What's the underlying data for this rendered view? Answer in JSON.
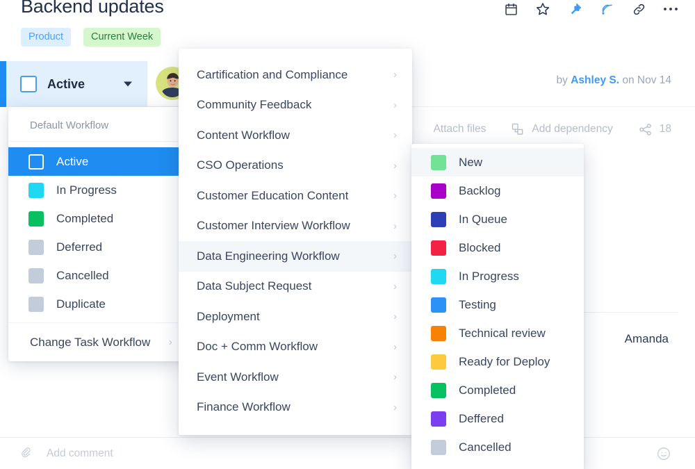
{
  "page": {
    "task_title": "Backend updates",
    "tags": [
      {
        "label": "Product",
        "bg": "#ddeeff",
        "fg": "#4da2f7"
      },
      {
        "label": "Current Week",
        "bg": "#d4f7cd",
        "fg": "#2f7a3f"
      }
    ],
    "title_icons": [
      "calendar-icon",
      "star-icon",
      "pin-icon",
      "broadcast-icon",
      "link-icon",
      "more-icon"
    ],
    "status_chip": {
      "label": "Active",
      "accent": "#1e8cf0",
      "bg": "#e2effd"
    },
    "byline": {
      "prefix": "by",
      "author": "Ashley S.",
      "date": "on Nov 14"
    },
    "actions": {
      "attach_files": "Attach files",
      "add_dependency": "Add dependency",
      "share_count": "18"
    },
    "assignee_name": "Amanda",
    "comment": {
      "placeholder": "Add comment"
    }
  },
  "status_menu": {
    "header": "Default Workflow",
    "items": [
      {
        "label": "Active",
        "color": "#ffffff",
        "hollow": true,
        "selected": true
      },
      {
        "label": "In Progress",
        "color": "#1fd8f2",
        "hollow": false,
        "selected": false
      },
      {
        "label": "Completed",
        "color": "#07c160",
        "hollow": false,
        "selected": false
      },
      {
        "label": "Deferred",
        "color": "#c3ccdb",
        "hollow": false,
        "selected": false
      },
      {
        "label": "Cancelled",
        "color": "#c3ccdb",
        "hollow": false,
        "selected": false
      },
      {
        "label": "Duplicate",
        "color": "#c3ccdb",
        "hollow": false,
        "selected": false
      }
    ],
    "footer": {
      "label": "Change Task Workflow",
      "chevron": "›"
    }
  },
  "workflow_menu": {
    "items": [
      {
        "label": "Cartification and Compliance",
        "hovered": false
      },
      {
        "label": "Community Feedback",
        "hovered": false
      },
      {
        "label": "Content Workflow",
        "hovered": false
      },
      {
        "label": "CSO Operations",
        "hovered": false
      },
      {
        "label": "Customer Education Content",
        "hovered": false
      },
      {
        "label": "Customer Interview Workflow",
        "hovered": false
      },
      {
        "label": "Data Engineering Workflow",
        "hovered": true
      },
      {
        "label": "Data Subject Request",
        "hovered": false
      },
      {
        "label": "Deployment",
        "hovered": false
      },
      {
        "label": "Doc + Comm Workflow",
        "hovered": false
      },
      {
        "label": "Event Workflow",
        "hovered": false
      },
      {
        "label": "Finance Workflow",
        "hovered": false
      }
    ],
    "chevron": "›"
  },
  "state_submenu": {
    "items": [
      {
        "label": "New",
        "color": "#72e395",
        "hovered": true
      },
      {
        "label": "Backlog",
        "color": "#a800c8",
        "hovered": false
      },
      {
        "label": "In Queue",
        "color": "#2d3fb5",
        "hovered": false
      },
      {
        "label": "Blocked",
        "color": "#f22244",
        "hovered": false
      },
      {
        "label": "In Progress",
        "color": "#1fd8f2",
        "hovered": false
      },
      {
        "label": "Testing",
        "color": "#2b93f5",
        "hovered": false
      },
      {
        "label": "Technical review",
        "color": "#f78208",
        "hovered": false
      },
      {
        "label": "Ready for Deploy",
        "color": "#fcc93f",
        "hovered": false
      },
      {
        "label": "Completed",
        "color": "#07c160",
        "hovered": false
      },
      {
        "label": "Deffered",
        "color": "#7c3ff0",
        "hovered": false
      },
      {
        "label": "Cancelled",
        "color": "#c3ccdb",
        "hovered": false
      }
    ]
  }
}
